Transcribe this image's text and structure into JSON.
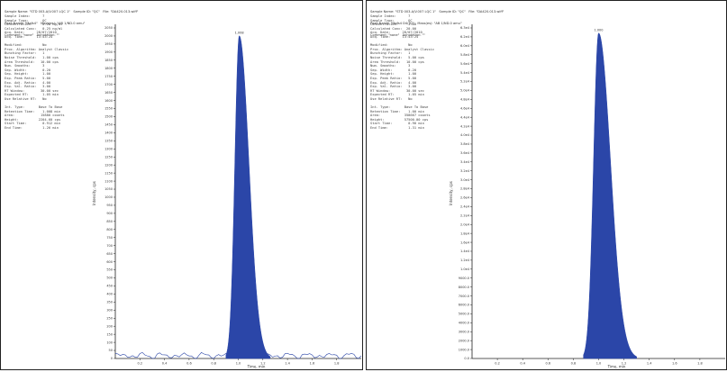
{
  "colors": {
    "peak": "#2b46a8",
    "baseline": "#2b46a8",
    "axis": "#222222",
    "border": "#222222"
  },
  "left": {
    "header": [
      "Sample Name: \"STD 003-A/V.007 LQC 1\"   Sample ID: \"QC\"   File: \"DA420.013.wiff\"",
      "Peak Name: \"Mafs4\"   Mass(es): \"AB 1/ND.0 amu\"",
      "Comment: \"none\"   Annotation: \"\""
    ],
    "info": [
      "Sample Index:      7",
      "Sample Type:       QC",
      "Concentration:     0.20 ng/ml",
      "Calculated Conc:   0.25 ng/ml",
      "Acq. Date:      28/07/2010",
      "Acq. Time:      13:43:24",
      "",
      "Modified:          No",
      "Proc. Algorithm: Analyst Classic",
      "Bunching Factor:   1",
      "Noise Threshold:   1.00 cps",
      "Area Threshold:   10.00 cps",
      "Num. Smooths:      3",
      "Sep. Width:        0.20",
      "Sep. Height:       1.00",
      "Exp. Peak Ratio:   5.00",
      "Exp. Adj. Ratio:   4.00",
      "Exp. Val. Ratio:   3.00",
      "RT Window:        30.00 sec",
      "Expected RT:       1.05 min",
      "Use Relative RT:   No",
      "",
      "Int. Type:       Base To Base",
      "Retention Time:    1.008 min",
      "Area:             15880 counts",
      "Height:          2204.60 cps",
      "Start Time:        0.912 min",
      "End Time:          1.26 min"
    ],
    "chart_data": {
      "type": "area",
      "title": "",
      "xlabel": "Time, min",
      "ylabel": "Intensity, cps",
      "xlim": [
        0,
        2.0
      ],
      "ylim": [
        0,
        2100
      ],
      "x_ticks": [
        "0.2",
        "0.4",
        "0.6",
        "0.8",
        "1.0",
        "1.2",
        "1.4",
        "1.6",
        "1.8"
      ],
      "y_ticks": [
        "2050",
        "2000",
        "1950",
        "1900",
        "1850",
        "1800",
        "1750",
        "1700",
        "1650",
        "1600",
        "1550",
        "1500",
        "1450",
        "1400",
        "1350",
        "1300",
        "1250",
        "1200",
        "1150",
        "1100",
        "1050",
        "1000",
        "950",
        "900",
        "850",
        "800",
        "750",
        "700",
        "650",
        "600",
        "550",
        "500",
        "450",
        "400",
        "350",
        "300",
        "250",
        "200",
        "150",
        "100",
        "50",
        "0"
      ],
      "peak_label": "1.008",
      "peak": {
        "rt": 1.008,
        "height": 2050,
        "start": 0.9,
        "end": 1.26
      },
      "baseline_noise": true
    }
  },
  "right": {
    "header": [
      "Sample Name: \"STD 003-A/V.007 LQC 1\"   Sample ID: \"QC\"   File: \"DA420.013.wiff\"",
      "Peak Name: \"Mafs4 D4(IS)\"   Mass(es): \"AB 1/ND.0 amu\"",
      "Comment: \"none\"   Annotation: \"\""
    ],
    "info": [
      "Sample Index:      7",
      "Sample Type:       QC",
      "Concentration:     1.00",
      "Calculated Conc:  20.00",
      "Acq. Date:      28/07/2010",
      "Acq. Time:      13:43:24",
      "",
      "Modified:          No",
      "Proc. Algorithm: Analyst Classic",
      "Bunching Factor:   1",
      "Noise Threshold:   5.00 cps",
      "Area Threshold:   10.00 cps",
      "Num. Smooths:      3",
      "Sep. Width:        0.20",
      "Sep. Height:       1.00",
      "Exp. Peak Ratio:   5.00",
      "Exp. Adj. Ratio:   4.00",
      "Exp. Val. Ratio:   3.00",
      "RT Window:        30.00 sec",
      "Expected RT:       1.05 min",
      "Use Relative RT:   No",
      "",
      "Int. Type:       Base To Base",
      "Retention Time:    1.00 min",
      "Area:            358667 counts",
      "Height:          57500.00 cps",
      "Start Time:        0.90 min",
      "End Time:          1.31 min"
    ],
    "chart_data": {
      "type": "area",
      "title": "",
      "xlabel": "Time, min",
      "ylabel": "Intensity, cps",
      "xlim": [
        0,
        2.0
      ],
      "ylim": [
        0,
        64000
      ],
      "x_ticks": [
        "0.2",
        "0.4",
        "0.6",
        "0.8",
        "1.0",
        "1.2",
        "1.4",
        "1.6",
        "1.8"
      ],
      "y_ticks": [
        "6.3e4",
        "6.2e4",
        "6.0e4",
        "5.8e4",
        "5.6e4",
        "5.4e4",
        "5.2e4",
        "5.0e4",
        "4.8e4",
        "4.6e4",
        "4.4e4",
        "4.2e4",
        "4.0e4",
        "3.8e4",
        "3.6e4",
        "3.4e4",
        "3.2e4",
        "3.0e4",
        "2.8e4",
        "2.6e4",
        "2.4e4",
        "2.2e4",
        "2.0e4",
        "1.8e4",
        "1.6e4",
        "1.4e4",
        "1.2e4",
        "1.0e4",
        "9000.0",
        "8000.0",
        "7000.0",
        "6000.0",
        "5000.0",
        "4000.0",
        "3000.0",
        "2000.0",
        "1000.0",
        "0.0"
      ],
      "peak_label": "1.000",
      "peak": {
        "rt": 1.0,
        "height": 63000,
        "start": 0.88,
        "end": 1.3
      },
      "baseline_noise": false
    }
  }
}
